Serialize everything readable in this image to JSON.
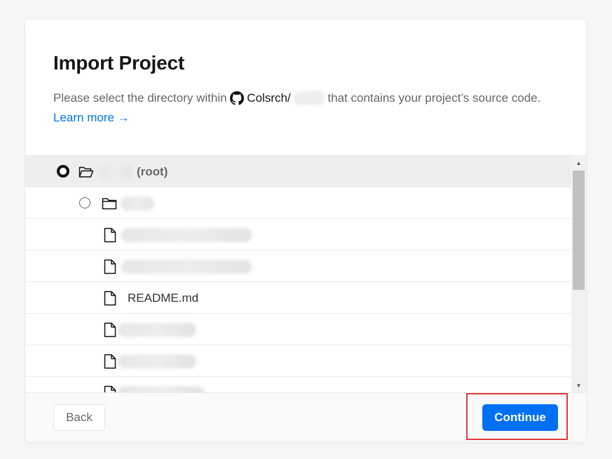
{
  "dialog": {
    "title": "Import Project",
    "description_before": "Please select the directory within",
    "repo_owner": "Colsrch/",
    "description_after": "that contains your project’s source code.",
    "learn_more": "Learn more →"
  },
  "tree": {
    "root_suffix": "(root)",
    "readme": "README.md"
  },
  "footer": {
    "back_label": "Back",
    "continue_label": "Continue"
  },
  "colors": {
    "accent": "#0070f3",
    "highlight": "#e23b3b"
  }
}
